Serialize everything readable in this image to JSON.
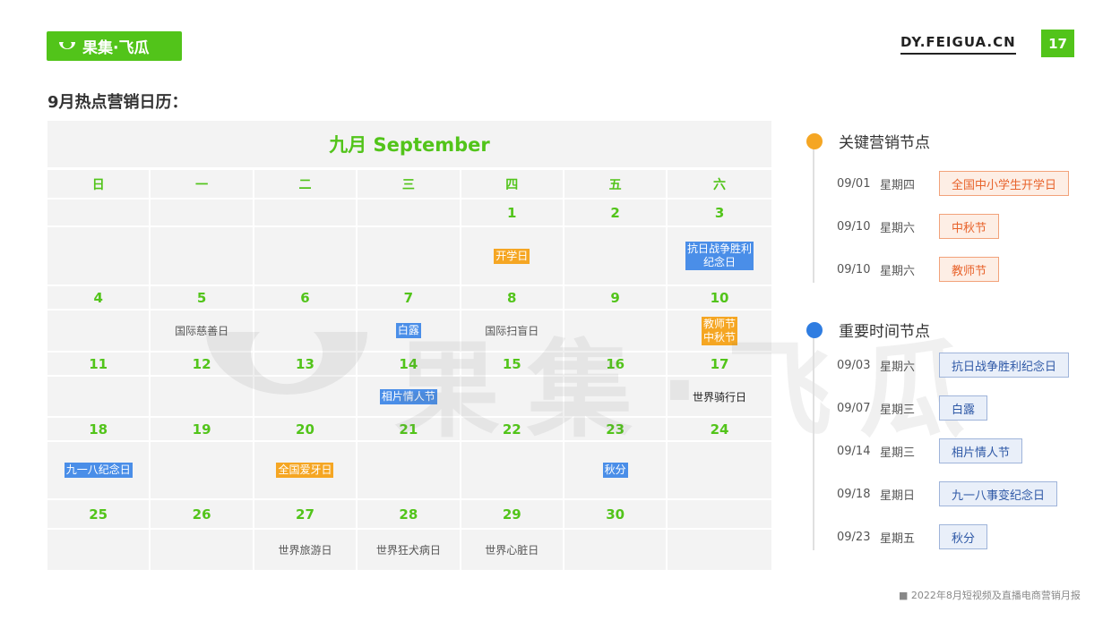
{
  "logo": {
    "text": "果集·飞瓜"
  },
  "site": "DY.FEIGUA.CN",
  "page_number": "17",
  "heading": "9月热点营销日历：",
  "watermark": "果集·飞瓜",
  "calendar": {
    "title": "九月 September",
    "weekdays": [
      "日",
      "一",
      "二",
      "三",
      "四",
      "五",
      "六"
    ],
    "weeks": [
      {
        "days": [
          "",
          "",
          "",
          "",
          "1",
          "2",
          "3"
        ],
        "events": [
          [],
          [],
          [],
          [],
          [
            {
              "text": "开学日",
              "style": "orange"
            }
          ],
          [],
          [
            {
              "text": "抗日战争胜利\n纪念日",
              "style": "blue"
            }
          ]
        ]
      },
      {
        "days": [
          "4",
          "5",
          "6",
          "7",
          "8",
          "9",
          "10"
        ],
        "events": [
          [],
          [
            {
              "text": "国际慈善日",
              "style": "plain"
            }
          ],
          [],
          [
            {
              "text": "白露",
              "style": "blue"
            }
          ],
          [
            {
              "text": "国际扫盲日",
              "style": "plain"
            }
          ],
          [],
          [
            {
              "text": "教师节\n中秋节",
              "style": "orange"
            }
          ]
        ]
      },
      {
        "days": [
          "11",
          "12",
          "13",
          "14",
          "15",
          "16",
          "17"
        ],
        "events": [
          [],
          [],
          [],
          [
            {
              "text": "相片情人节",
              "style": "blue"
            }
          ],
          [],
          [],
          [
            {
              "text": "世界骑行日",
              "style": "dark"
            }
          ]
        ]
      },
      {
        "days": [
          "18",
          "19",
          "20",
          "21",
          "22",
          "23",
          "24"
        ],
        "events": [
          [
            {
              "text": "九一八纪念日",
              "style": "blue"
            }
          ],
          [],
          [
            {
              "text": "全国爱牙日",
              "style": "orange"
            }
          ],
          [],
          [],
          [
            {
              "text": "秋分",
              "style": "blue"
            }
          ],
          []
        ]
      },
      {
        "days": [
          "25",
          "26",
          "27",
          "28",
          "29",
          "30",
          ""
        ],
        "events": [
          [],
          [],
          [
            {
              "text": "世界旅游日",
              "style": "plain"
            }
          ],
          [
            {
              "text": "世界狂犬病日",
              "style": "plain"
            }
          ],
          [
            {
              "text": "世界心脏日",
              "style": "plain"
            }
          ],
          [],
          []
        ]
      }
    ]
  },
  "key_nodes": {
    "title": "关键营销节点",
    "color": "#f5a623",
    "items": [
      {
        "date": "09/01",
        "weekday": "星期四",
        "label": "全国中小学生开学日"
      },
      {
        "date": "09/10",
        "weekday": "星期六",
        "label": "中秋节"
      },
      {
        "date": "09/10",
        "weekday": "星期六",
        "label": "教师节"
      }
    ]
  },
  "important_nodes": {
    "title": "重要时间节点",
    "color": "#2f7de1",
    "items": [
      {
        "date": "09/03",
        "weekday": "星期六",
        "label": "抗日战争胜利纪念日"
      },
      {
        "date": "09/07",
        "weekday": "星期三",
        "label": "白露"
      },
      {
        "date": "09/14",
        "weekday": "星期三",
        "label": "相片情人节"
      },
      {
        "date": "09/18",
        "weekday": "星期日",
        "label": "九一八事变纪念日"
      },
      {
        "date": "09/23",
        "weekday": "星期五",
        "label": "秋分"
      }
    ]
  },
  "footer": "■  2022年8月短视频及直播电商营销月报"
}
